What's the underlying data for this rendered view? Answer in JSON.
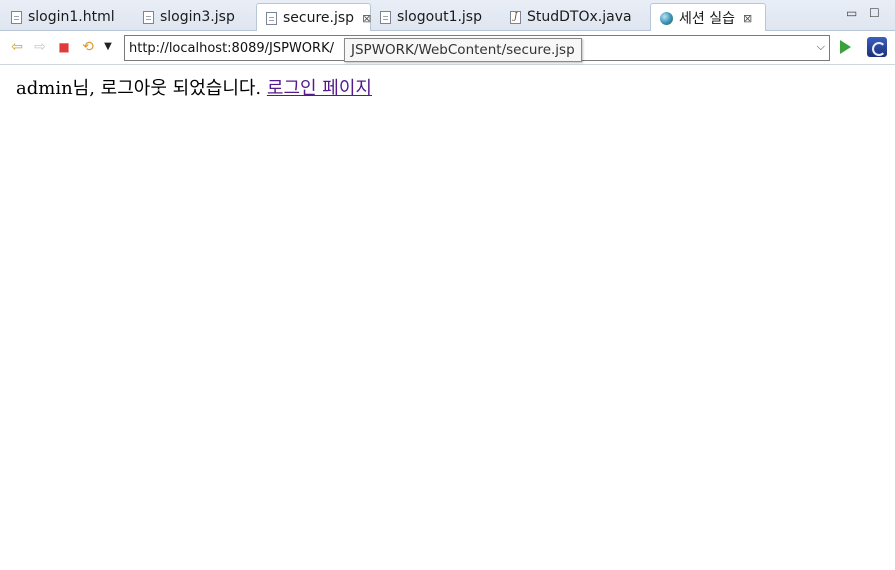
{
  "tabs": [
    {
      "label": "slogin1.html",
      "icon": "file-icon",
      "active": false
    },
    {
      "label": "slogin3.jsp",
      "icon": "file-icon",
      "active": false
    },
    {
      "label": "secure.jsp",
      "icon": "file-icon",
      "active": true,
      "close": "⊠"
    },
    {
      "label": "slogout1.jsp",
      "icon": "file-icon",
      "active": false
    },
    {
      "label": "StudDTOx.java",
      "icon": "java-file-icon",
      "active": false
    },
    {
      "label": "세션 실습",
      "icon": "globe-icon",
      "active": false,
      "close": "⊠"
    }
  ],
  "window_controls": {
    "minimize": "▭",
    "maximize": "☐"
  },
  "toolbar": {
    "back": "⇦",
    "forward": "⇨",
    "stop": "■",
    "refresh": "⟲",
    "menu": "▼"
  },
  "address": {
    "value": "http://localhost:8089/JSPWORK/",
    "dropdown": "⌵",
    "tooltip": "JSPWORK/WebContent/secure.jsp"
  },
  "page": {
    "message": "admin님, 로그아웃 되었습니다.",
    "link": "로그인 페이지"
  },
  "colors": {
    "link_visited": "#551a8b",
    "stop": "#e23a3a",
    "go": "#3aa23a"
  }
}
